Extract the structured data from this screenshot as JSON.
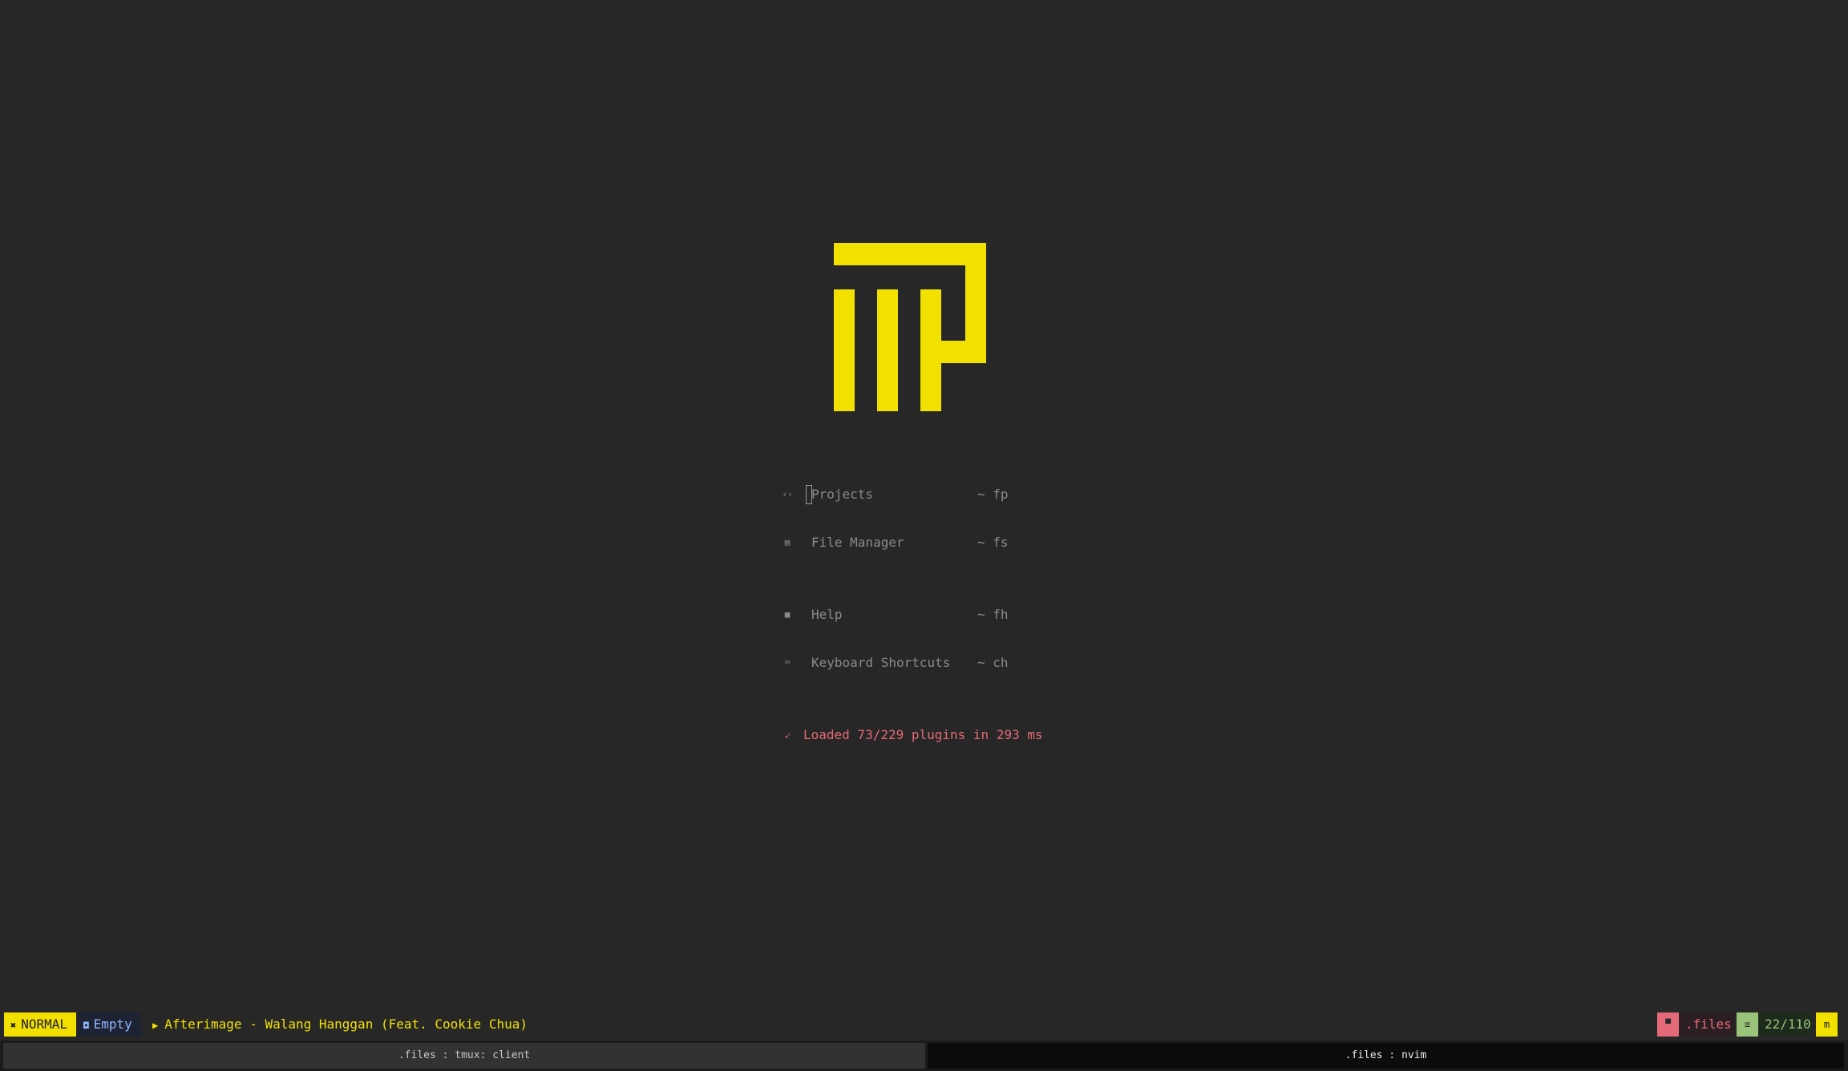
{
  "dashboard": {
    "logo_name": "yellow-block-logo",
    "logo_color": "#f2e000",
    "items": [
      {
        "icon": "folder-code-icon",
        "glyph": "‹›",
        "label": "Projects",
        "key": "~ fp"
      },
      {
        "icon": "file-manager-icon",
        "glyph": "▤",
        "label": "File Manager",
        "key": "~ fs"
      },
      {
        "icon": "help-icon",
        "glyph": "■",
        "label": "Help",
        "key": "~ fh"
      },
      {
        "icon": "keyboard-icon",
        "glyph": "⌨",
        "label": "Keyboard Shortcuts",
        "key": "~ ch"
      }
    ],
    "footer": {
      "icon": "rocket-icon",
      "glyph": "➶",
      "text": "Loaded 73/229 plugins in 293 ms",
      "color": "#e46a78"
    }
  },
  "statusline": {
    "mode_glyph": "✖",
    "mode": "NORMAL",
    "buffer_glyph": "◘",
    "buffer": "Empty",
    "music_glyph": "▶",
    "music": "Afterimage - Walang Hanggan (Feat. Cookie Chua)",
    "dir_glyph": "▀",
    "dir": ".files",
    "pos_glyph": "≡",
    "position": "22/110",
    "end_glyph": "m",
    "colors": {
      "mode_bg": "#f2e000",
      "dir_accent": "#e46a78",
      "pos_accent": "#98c379"
    }
  },
  "tmux": {
    "left_pane": ".files : tmux: client",
    "right_pane": ".files : nvim"
  }
}
